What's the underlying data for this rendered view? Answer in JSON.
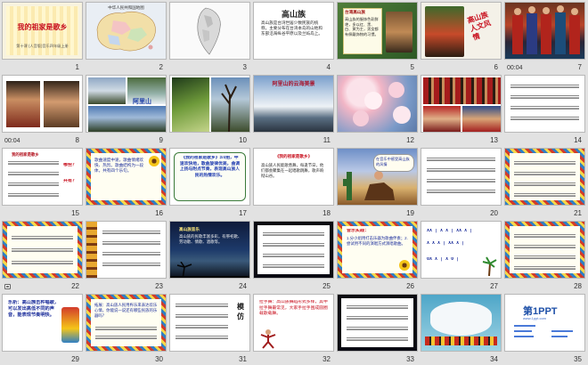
{
  "slides": [
    {
      "num": "1",
      "title": "我的祖家是歌乡",
      "subtitle": "第十课 (人音版)音乐四年级上册",
      "dur": ""
    },
    {
      "num": "2",
      "title": "中华人民共和国地图",
      "dur": ""
    },
    {
      "num": "3",
      "dur": ""
    },
    {
      "num": "4",
      "title": "高山族",
      "body": "高山族是台湾世居少数民族的统称，主要分布在台湾本岛的山地和东部沿海纵谷平原以及兰屿岛上。",
      "dur": ""
    },
    {
      "num": "5",
      "title": "台湾高山族",
      "body": "高山族的服饰色彩鲜艳，多以红、黑、白、黄为主，男女都有佩戴饰物的习惯。",
      "dur": ""
    },
    {
      "num": "6",
      "title": "高山族 人文风情",
      "dur": ""
    },
    {
      "num": "7",
      "dur": "00:04"
    },
    {
      "num": "8",
      "dur": "00:04"
    },
    {
      "num": "9",
      "caption": "阿里山",
      "dur": ""
    },
    {
      "num": "10",
      "dur": ""
    },
    {
      "num": "11",
      "title": "阿里山的云海美景",
      "dur": ""
    },
    {
      "num": "12",
      "dur": ""
    },
    {
      "num": "13",
      "dur": ""
    },
    {
      "num": "14",
      "dur": ""
    },
    {
      "num": "15",
      "title": "我的祖家是歌乡",
      "side_a": "哪些？",
      "side_b": "共有？",
      "dur": ""
    },
    {
      "num": "16",
      "body": "歌曲速度中速，歌曲情绪欢快、热烈。歌曲结构为一段体，共有四个乐句。",
      "dur": ""
    },
    {
      "num": "17",
      "body": "《我的祖家是歌乡》2/4拍，中速欢快地，歌曲旋律优美，曲调上扬与附点节奏，表现高山族人民的热情欢乐。",
      "dur": ""
    },
    {
      "num": "18",
      "title": "《我的祖家是歌乡》",
      "body": "高山族人民能歌善舞，每逢节日，他们都会聚集在一起唱歌跳舞，歌声响彻山谷。",
      "dur": ""
    },
    {
      "num": "19",
      "body": "在音乐中感受高山族的风情",
      "dur": ""
    },
    {
      "num": "20",
      "dur": ""
    },
    {
      "num": "21",
      "dur": ""
    },
    {
      "num": "22",
      "dur": ""
    },
    {
      "num": "23",
      "dur": ""
    },
    {
      "num": "24",
      "title": "高山族音乐",
      "body": "高山族的民歌丰富多彩，有祭祀歌、劳动歌、情歌、酒歌等。",
      "dur": ""
    },
    {
      "num": "25",
      "dur": ""
    },
    {
      "num": "26",
      "title": "音乐实践：",
      "body": "1.分小组用打击乐器为歌曲伴奏；2.尝试用不同的演唱方式演唱歌曲。",
      "dur": ""
    },
    {
      "num": "27",
      "rhythm": [
        "XX | X X | XX X |",
        "X X X | XX X |",
        "0X X | X 0 |"
      ],
      "dur": ""
    },
    {
      "num": "28",
      "dur": ""
    },
    {
      "num": "29",
      "body": "乐析：高山族击杵唱歌，可以发出高低不同的声音，能表现节奏明快。",
      "dur": ""
    },
    {
      "num": "30",
      "body": "拓展：高山族人民用杵乐来表达欢乐心情，你能说一说还有哪些民族的乐器吗？",
      "dur": ""
    },
    {
      "num": "31",
      "title": "模仿",
      "dur": ""
    },
    {
      "num": "32",
      "body": "拉手舞：高山族舞蹈形式多样，其中拉手舞最常见，大家手拉手围成圆圈载歌载舞。",
      "dur": ""
    },
    {
      "num": "33",
      "dur": ""
    },
    {
      "num": "34",
      "dur": ""
    },
    {
      "num": "35",
      "brand": "第1PPT",
      "brand_sub": "www.1ppt.com",
      "dur": ""
    }
  ],
  "colors": {
    "panel": "#e2e2e2",
    "selected_border": "#4a8ec8",
    "title_red": "#c8101e",
    "dark_slide": "#0a0a12"
  }
}
